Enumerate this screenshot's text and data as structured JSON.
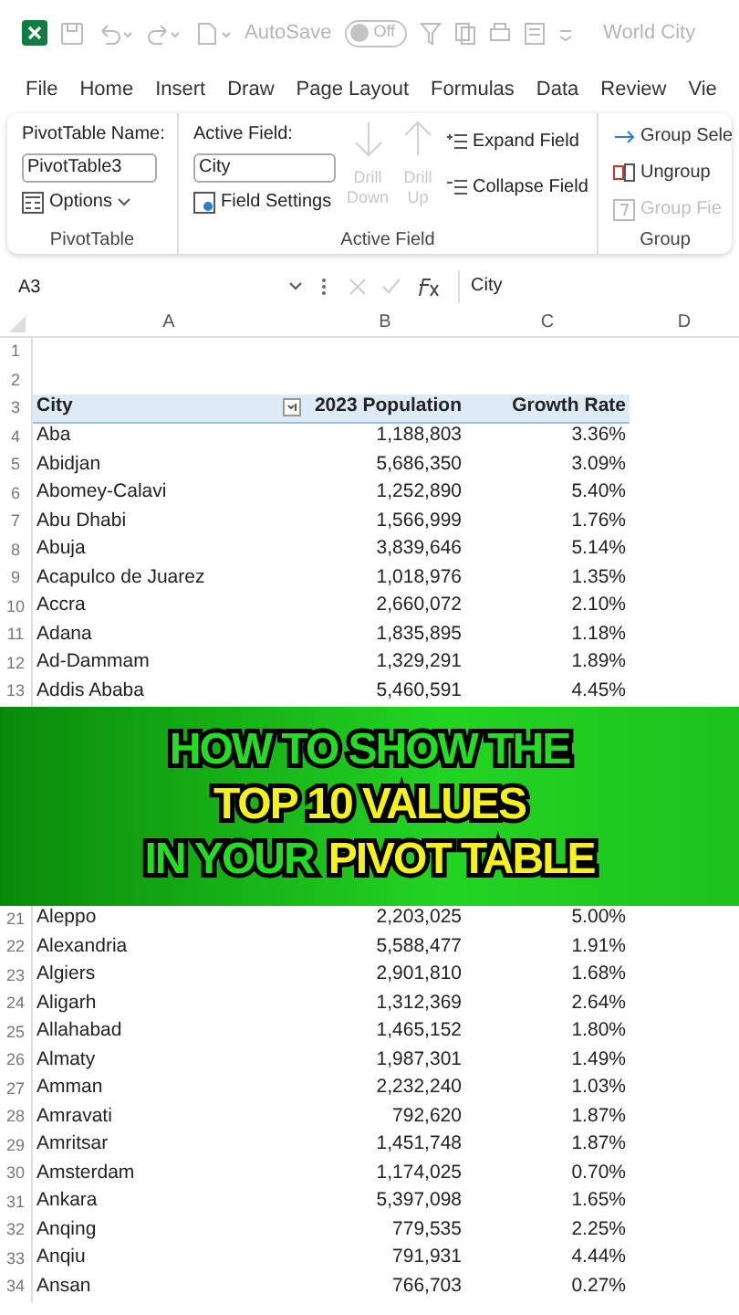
{
  "title_bar": {
    "autosave_label": "AutoSave",
    "autosave_toggle": {
      "label": "Off",
      "on": false
    },
    "document_title": "World City"
  },
  "menu_tabs": [
    "File",
    "Home",
    "Insert",
    "Draw",
    "Page Layout",
    "Formulas",
    "Data",
    "Review",
    "Vie"
  ],
  "ribbon": {
    "pivottable_group": {
      "name_label": "PivotTable Name:",
      "name_value": "PivotTable3",
      "options": "Options",
      "caption": "PivotTable"
    },
    "active_field_group": {
      "field_label": "Active Field:",
      "field_value": "City",
      "field_settings": "Field Settings",
      "drill_buttons": [
        {
          "label": "Drill Down",
          "disabled": true
        },
        {
          "label": "Drill Up",
          "disabled": true
        }
      ],
      "expand": "Expand Field",
      "collapse": "Collapse Field",
      "caption": "Active Field"
    },
    "group_group": {
      "items": [
        {
          "label": "Group Sele",
          "disabled": false
        },
        {
          "label": "Ungroup",
          "disabled": false
        },
        {
          "label": "Group Fie",
          "disabled": true
        }
      ],
      "caption": "Group"
    }
  },
  "formula_bar": {
    "name_box": "A3",
    "value": "City"
  },
  "columns": [
    "A",
    "B",
    "C",
    "D"
  ],
  "rows": [
    {
      "number": "1",
      "kind": "blank"
    },
    {
      "number": "2",
      "kind": "blank"
    },
    {
      "number": "3",
      "kind": "header",
      "cells": [
        "City",
        "2023 Population",
        "Growth Rate"
      ]
    },
    {
      "number": "4",
      "kind": "data",
      "cells": [
        "Aba",
        "1,188,803",
        "3.36%"
      ]
    },
    {
      "number": "5",
      "kind": "data",
      "cells": [
        "Abidjan",
        "5,686,350",
        "3.09%"
      ]
    },
    {
      "number": "6",
      "kind": "data",
      "cells": [
        "Abomey-Calavi",
        "1,252,890",
        "5.40%"
      ]
    },
    {
      "number": "7",
      "kind": "data",
      "cells": [
        "Abu Dhabi",
        "1,566,999",
        "1.76%"
      ]
    },
    {
      "number": "8",
      "kind": "data",
      "cells": [
        "Abuja",
        "3,839,646",
        "5.14%"
      ]
    },
    {
      "number": "9",
      "kind": "data",
      "cells": [
        "Acapulco de Juarez",
        "1,018,976",
        "1.35%"
      ]
    },
    {
      "number": "10",
      "kind": "data",
      "cells": [
        "Accra",
        "2,660,072",
        "2.10%"
      ]
    },
    {
      "number": "11",
      "kind": "data",
      "cells": [
        "Adana",
        "1,835,895",
        "1.18%"
      ]
    },
    {
      "number": "12",
      "kind": "data",
      "cells": [
        "Ad-Dammam",
        "1,329,291",
        "1.89%"
      ]
    },
    {
      "number": "13",
      "kind": "data",
      "cells": [
        "Addis Ababa",
        "5,460,591",
        "4.45%"
      ]
    },
    {
      "kind": "banner",
      "lines": [
        [
          {
            "text": "HOW TO SHOW THE",
            "color": "#22dd22"
          }
        ],
        [
          {
            "text": "TOP 10 VALUES",
            "color": "#f5f21a"
          }
        ],
        [
          {
            "text": "IN YOUR",
            "color": "#22dd22"
          },
          {
            "text": "PIVOT TABLE",
            "color": "#f5f21a"
          }
        ]
      ]
    },
    {
      "number": "21",
      "kind": "data",
      "cells": [
        "Aleppo",
        "2,203,025",
        "5.00%"
      ]
    },
    {
      "number": "22",
      "kind": "data",
      "cells": [
        "Alexandria",
        "5,588,477",
        "1.91%"
      ]
    },
    {
      "number": "23",
      "kind": "data",
      "cells": [
        "Algiers",
        "2,901,810",
        "1.68%"
      ]
    },
    {
      "number": "24",
      "kind": "data",
      "cells": [
        "Aligarh",
        "1,312,369",
        "2.64%"
      ]
    },
    {
      "number": "25",
      "kind": "data",
      "cells": [
        "Allahabad",
        "1,465,152",
        "1.80%"
      ]
    },
    {
      "number": "26",
      "kind": "data",
      "cells": [
        "Almaty",
        "1,987,301",
        "1.49%"
      ]
    },
    {
      "number": "27",
      "kind": "data",
      "cells": [
        "Amman",
        "2,232,240",
        "1.03%"
      ]
    },
    {
      "number": "28",
      "kind": "data",
      "cells": [
        "Amravati",
        "792,620",
        "1.87%"
      ]
    },
    {
      "number": "29",
      "kind": "data",
      "cells": [
        "Amritsar",
        "1,451,748",
        "1.87%"
      ]
    },
    {
      "number": "30",
      "kind": "data",
      "cells": [
        "Amsterdam",
        "1,174,025",
        "0.70%"
      ]
    },
    {
      "number": "31",
      "kind": "data",
      "cells": [
        "Ankara",
        "5,397,098",
        "1.65%"
      ]
    },
    {
      "number": "32",
      "kind": "data",
      "cells": [
        "Anqing",
        "779,535",
        "2.25%"
      ]
    },
    {
      "number": "33",
      "kind": "data",
      "cells": [
        "Anqiu",
        "791,931",
        "4.44%"
      ]
    },
    {
      "number": "34",
      "kind": "data",
      "cells": [
        "Ansan",
        "766,703",
        "0.27%"
      ]
    }
  ]
}
